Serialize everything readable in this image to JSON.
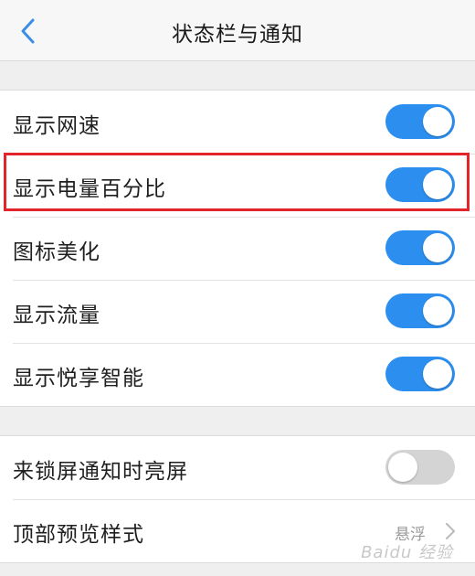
{
  "header": {
    "title": "状态栏与通知"
  },
  "group1": [
    {
      "label": "显示网速",
      "toggle": "on"
    },
    {
      "label": "显示电量百分比",
      "toggle": "on"
    },
    {
      "label": "图标美化",
      "toggle": "on"
    },
    {
      "label": "显示流量",
      "toggle": "on"
    },
    {
      "label": "显示悦享智能",
      "toggle": "on"
    }
  ],
  "group2": [
    {
      "label": "来锁屏通知时亮屏",
      "toggle": "off"
    },
    {
      "label": "顶部预览样式",
      "value": "悬浮"
    }
  ],
  "watermark": "Baidu 经验",
  "colors": {
    "toggle_on": "#2c8ff0",
    "toggle_off": "#d4d4d4",
    "highlight": "#e4242b",
    "back_arrow": "#3a8ee6"
  },
  "icons": {
    "back": "chevron-left-icon",
    "row_arrow": "chevron-right-icon"
  }
}
